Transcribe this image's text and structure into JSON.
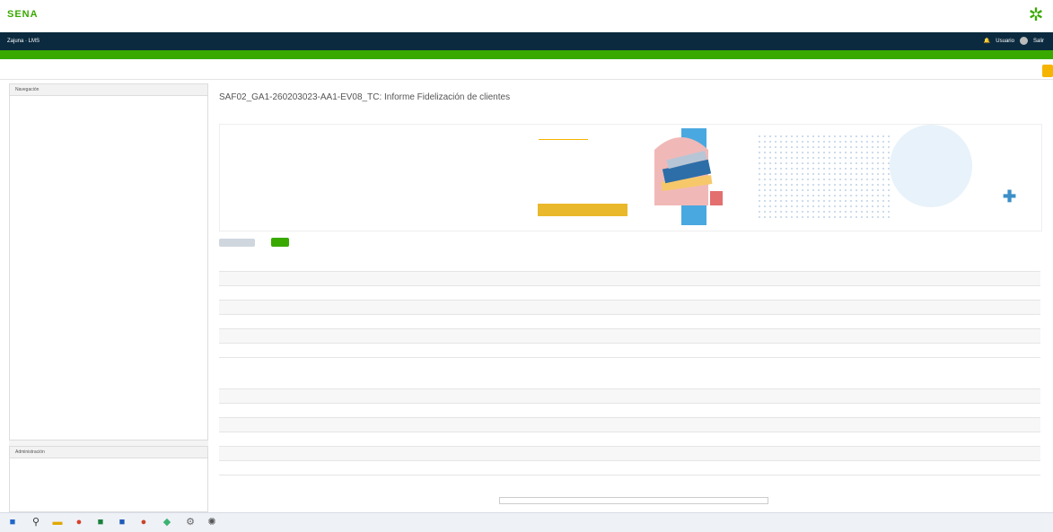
{
  "header": {
    "logo_text": "SENA",
    "brand_icon": "sena-logo-icon"
  },
  "navbar": {
    "left_text": "Zajuna · LMS",
    "user_text": "Usuario",
    "exit_text": "Salir"
  },
  "green_bar_text": "",
  "crumb_text": "",
  "sidebar": {
    "nav_title": "Navegación",
    "nav_items": [
      "",
      "",
      "",
      "",
      "",
      "",
      "",
      "",
      "",
      "",
      "",
      "",
      "",
      "",
      "",
      "",
      "",
      "",
      "",
      "",
      "",
      "",
      "",
      "",
      "",
      "",
      "",
      "",
      "",
      "",
      "",
      "",
      "",
      "",
      "",
      "",
      "",
      "",
      "",
      "",
      "",
      "",
      "",
      "",
      "",
      "",
      "",
      "",
      "",
      "",
      "",
      "",
      "",
      "",
      ""
    ],
    "admin_title": "Administración",
    "admin_items": [
      "",
      "",
      "",
      "",
      "",
      "",
      "",
      "",
      ""
    ]
  },
  "main": {
    "mini_crumb": "",
    "title": "SAF02_GA1-260203023-AA1-EV08_TC: Informe Fidelización de clientes",
    "opened": "",
    "due": "",
    "info": {
      "heading": "",
      "body": "",
      "check": "",
      "button": ""
    },
    "btn_grey": "",
    "btn_green": "",
    "summary_title": "",
    "summary": [
      {
        "k": "",
        "v": ""
      },
      {
        "k": "",
        "v": ""
      },
      {
        "k": "",
        "v": ""
      },
      {
        "k": "",
        "v": ""
      },
      {
        "k": "",
        "v": ""
      },
      {
        "k": "",
        "v": ""
      }
    ],
    "submission_title": "",
    "submission": [
      {
        "k": "",
        "v": ""
      },
      {
        "k": "",
        "v": ""
      },
      {
        "k": "",
        "v": ""
      },
      {
        "k": "",
        "v": ""
      },
      {
        "k": "",
        "v": ""
      },
      {
        "k": "",
        "v": ""
      }
    ],
    "prev_link": "",
    "jump_select": "",
    "next_link": ""
  },
  "taskbar": {
    "time": "",
    "date": ""
  }
}
